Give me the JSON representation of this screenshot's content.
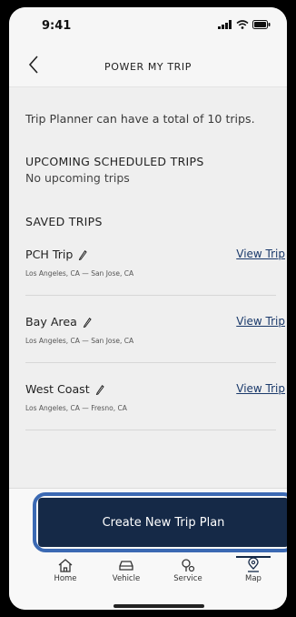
{
  "status": {
    "time": "9:41"
  },
  "header": {
    "title": "POWER MY TRIP"
  },
  "content": {
    "limit_text": "Trip Planner can have a total of 10 trips.",
    "upcoming_heading": "UPCOMING SCHEDULED TRIPS",
    "upcoming_empty": "No upcoming trips",
    "saved_heading": "SAVED TRIPS",
    "trips": [
      {
        "name": "PCH Trip",
        "route": "Los Angeles, CA — San Jose, CA",
        "link": "View Trip"
      },
      {
        "name": "Bay Area",
        "route": "Los Angeles, CA — San Jose, CA",
        "link": "View Trip"
      },
      {
        "name": "West Coast",
        "route": "Los Angeles, CA — Fresno, CA",
        "link": "View Trip"
      }
    ]
  },
  "footer": {
    "cta_label": "Create New Trip Plan",
    "tabs": [
      {
        "label": "Home",
        "icon": "home-icon"
      },
      {
        "label": "Vehicle",
        "icon": "vehicle-icon"
      },
      {
        "label": "Service",
        "icon": "service-icon"
      },
      {
        "label": "Map",
        "icon": "map-pin-icon",
        "active": true
      }
    ]
  },
  "colors": {
    "accent": "#152947",
    "link": "#1b3a6b",
    "highlight": "#3b69b3"
  }
}
